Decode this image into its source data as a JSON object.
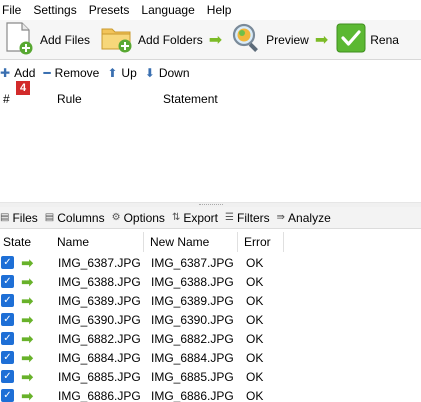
{
  "menu": [
    "File",
    "Settings",
    "Presets",
    "Language",
    "Help"
  ],
  "toolbar": {
    "add_files": "Add Files",
    "add_folders": "Add Folders",
    "preview": "Preview",
    "rename": "Rena"
  },
  "rules_bar": {
    "add": "Add",
    "remove": "Remove",
    "up": "Up",
    "down": "Down"
  },
  "rules_header": {
    "num": "#",
    "rule": "Rule",
    "statement": "Statement"
  },
  "callout_badge": "4",
  "files_bar": {
    "files": "Files",
    "columns": "Columns",
    "options": "Options",
    "export": "Export",
    "filters": "Filters",
    "analyze": "Analyze"
  },
  "grid_header": {
    "state": "State",
    "name": "Name",
    "new_name": "New Name",
    "error": "Error"
  },
  "files": [
    {
      "name": "IMG_6387.JPG",
      "new_name": "IMG_6387.JPG",
      "error": "OK"
    },
    {
      "name": "IMG_6388.JPG",
      "new_name": "IMG_6388.JPG",
      "error": "OK"
    },
    {
      "name": "IMG_6389.JPG",
      "new_name": "IMG_6389.JPG",
      "error": "OK"
    },
    {
      "name": "IMG_6390.JPG",
      "new_name": "IMG_6390.JPG",
      "error": "OK"
    },
    {
      "name": "IMG_6882.JPG",
      "new_name": "IMG_6882.JPG",
      "error": "OK"
    },
    {
      "name": "IMG_6884.JPG",
      "new_name": "IMG_6884.JPG",
      "error": "OK"
    },
    {
      "name": "IMG_6885.JPG",
      "new_name": "IMG_6885.JPG",
      "error": "OK"
    },
    {
      "name": "IMG_6886.JPG",
      "new_name": "IMG_6886.JPG",
      "error": "OK"
    }
  ],
  "colors": {
    "accent_green": "#7cbb27",
    "checkbox_blue": "#1e6fd6",
    "badge_red": "#d22b2b"
  }
}
